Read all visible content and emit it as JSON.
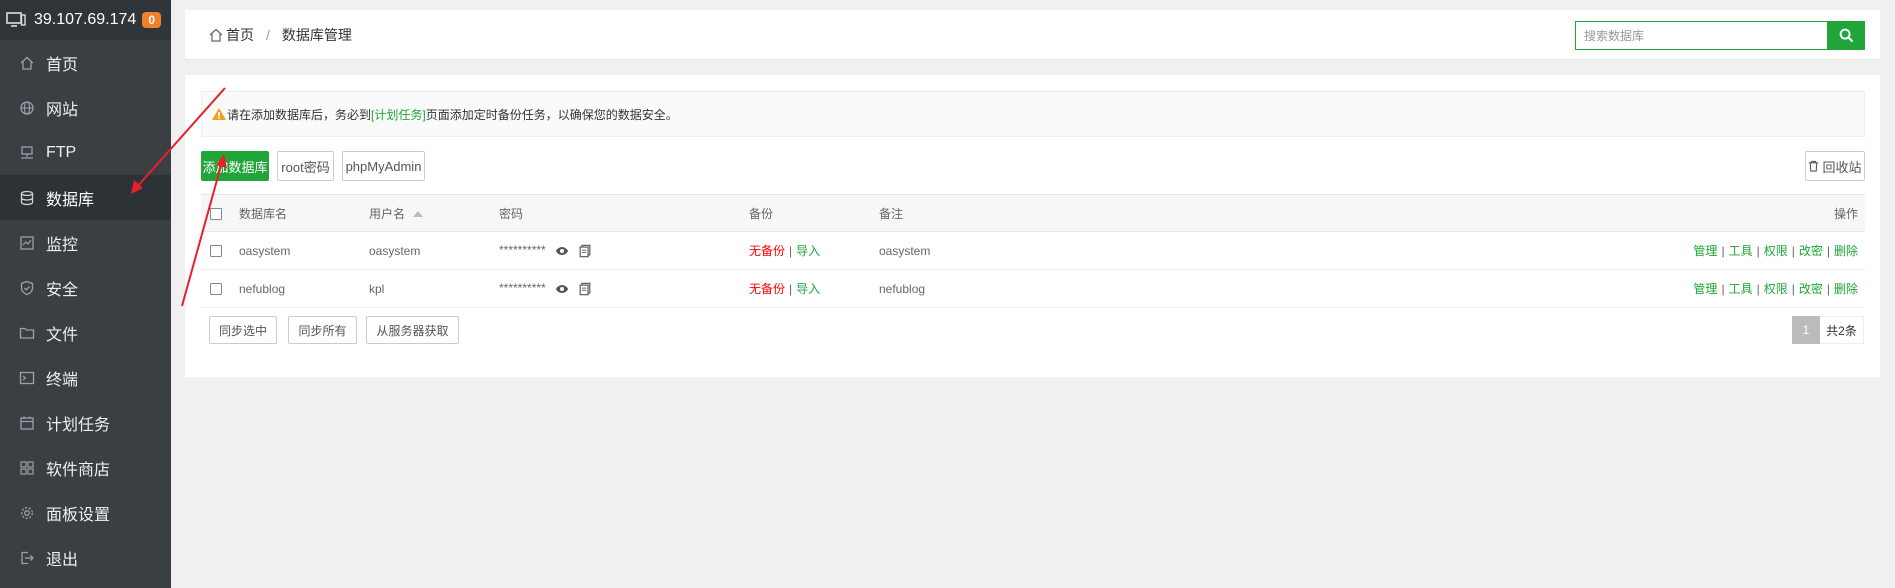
{
  "sidebar": {
    "server_ip": "39.107.69.174",
    "badge_count": "0",
    "items": [
      {
        "label": "首页",
        "icon": "home-icon"
      },
      {
        "label": "网站",
        "icon": "globe-icon"
      },
      {
        "label": "FTP",
        "icon": "ftp-icon"
      },
      {
        "label": "数据库",
        "icon": "database-icon",
        "active": true
      },
      {
        "label": "监控",
        "icon": "monitor-icon"
      },
      {
        "label": "安全",
        "icon": "shield-icon"
      },
      {
        "label": "文件",
        "icon": "folder-icon"
      },
      {
        "label": "终端",
        "icon": "terminal-icon"
      },
      {
        "label": "计划任务",
        "icon": "calendar-icon"
      },
      {
        "label": "软件商店",
        "icon": "grid-icon"
      },
      {
        "label": "面板设置",
        "icon": "gear-icon"
      },
      {
        "label": "退出",
        "icon": "logout-icon"
      }
    ]
  },
  "header": {
    "breadcrumb_home": "首页",
    "breadcrumb_sep": "/",
    "breadcrumb_current": "数据库管理",
    "search_placeholder": "搜索数据库"
  },
  "alert": {
    "text_before": "请在添加数据库后，务必到",
    "link": "[计划任务]",
    "text_after": "页面添加定时备份任务，以确保您的数据安全。"
  },
  "toolbar": {
    "add_db": "添加数据库",
    "root_pass": "root密码",
    "phpmyadmin": "phpMyAdmin",
    "recycle_bin": "回收站"
  },
  "table": {
    "headers": {
      "name": "数据库名",
      "user": "用户名",
      "password": "密码",
      "backup": "备份",
      "note": "备注",
      "ops": "操作"
    },
    "rows": [
      {
        "name": "oasystem",
        "user": "oasystem",
        "password": "**********",
        "backup_status": "无备份",
        "import": "导入",
        "note": "oasystem"
      },
      {
        "name": "nefublog",
        "user": "kpl",
        "password": "**********",
        "backup_status": "无备份",
        "import": "导入",
        "note": "nefublog"
      }
    ],
    "ops": {
      "manage": "管理",
      "tools": "工具",
      "perm": "权限",
      "chpass": "改密",
      "delete": "删除",
      "sep": "|"
    }
  },
  "footer": {
    "sync_selected": "同步选中",
    "sync_all": "同步所有",
    "fetch_server": "从服务器获取",
    "page_current": "1",
    "total": "共2条"
  },
  "colors": {
    "accent": "#20a53a",
    "sidebar": "#3a3f44",
    "warning": "#ff0000",
    "annotation_arrow": "#e8202a"
  }
}
